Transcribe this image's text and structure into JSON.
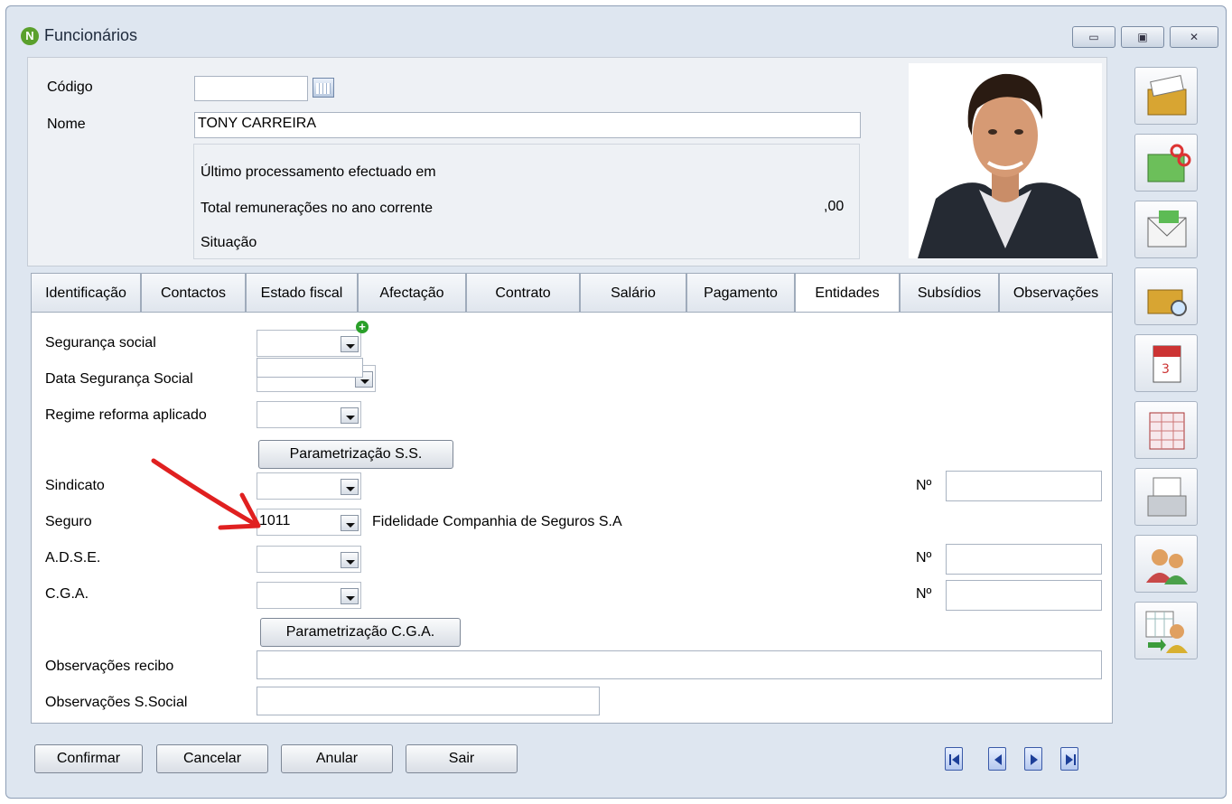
{
  "window": {
    "title": "Funcionários",
    "logo_letter": "N",
    "controls": [
      "minimize-icon",
      "maximize-icon",
      "close-icon"
    ]
  },
  "header": {
    "codigo_label": "Código",
    "codigo_value": "",
    "nome_label": "Nome",
    "nome_value": "TONY CARREIRA",
    "ultimo_label": "Último processamento efectuado em",
    "total_label": "Total remunerações no ano corrente",
    "total_value": ",00",
    "situacao_label": "Situação"
  },
  "side_toolbar": [
    "card-file-icon",
    "cut-document-icon",
    "mail-envelope-icon",
    "search-card-icon",
    "calendar-icon",
    "spreadsheet-icon",
    "document-stack-icon",
    "users-icon",
    "schedule-user-icon"
  ],
  "tabs": [
    {
      "label": "Identificação",
      "active": false
    },
    {
      "label": "Contactos",
      "active": false
    },
    {
      "label": "Estado fiscal",
      "active": false
    },
    {
      "label": "Afectação",
      "active": false
    },
    {
      "label": "Contrato",
      "active": false
    },
    {
      "label": "Salário",
      "active": false
    },
    {
      "label": "Pagamento",
      "active": false
    },
    {
      "label": "Entidades",
      "active": true
    },
    {
      "label": "Subsídios",
      "active": false
    },
    {
      "label": "Observações",
      "active": false
    }
  ],
  "form": {
    "seguranca_social_label": "Segurança social",
    "seguranca_social_value": "",
    "data_ss_label": "Data Segurança Social",
    "data_ss_value": "",
    "regime_label": "Regime reforma aplicado",
    "regime_value": "",
    "param_ss_button": "Parametrização S.S.",
    "sindicato_label": "Sindicato",
    "sindicato_value": "",
    "sindicato_num_label": "Nº",
    "sindicato_num_value": "",
    "seguro_label": "Seguro",
    "seguro_value": "1011",
    "seguro_desc": "Fidelidade Companhia de Seguros S.A",
    "adse_label": "A.D.S.E.",
    "adse_value": "",
    "adse_num_label": "Nº",
    "adse_num_value": "",
    "cga_label": "C.G.A.",
    "cga_value": "",
    "cga_num_label": "Nº",
    "cga_num_value": "",
    "param_cga_button": "Parametrização C.G.A.",
    "obs_recibo_label": "Observações recibo",
    "obs_recibo_value": "",
    "obs_ss_label": "Observações S.Social",
    "obs_ss_value": ""
  },
  "footer": {
    "confirmar": "Confirmar",
    "cancelar": "Cancelar",
    "anular": "Anular",
    "sair": "Sair",
    "nav": [
      "first-record-icon",
      "previous-record-icon",
      "next-record-icon",
      "last-record-icon"
    ]
  },
  "colors": {
    "window_bg": "#dee6f0",
    "annotation_arrow": "#e02020",
    "add_icon": "#2aa02a"
  }
}
